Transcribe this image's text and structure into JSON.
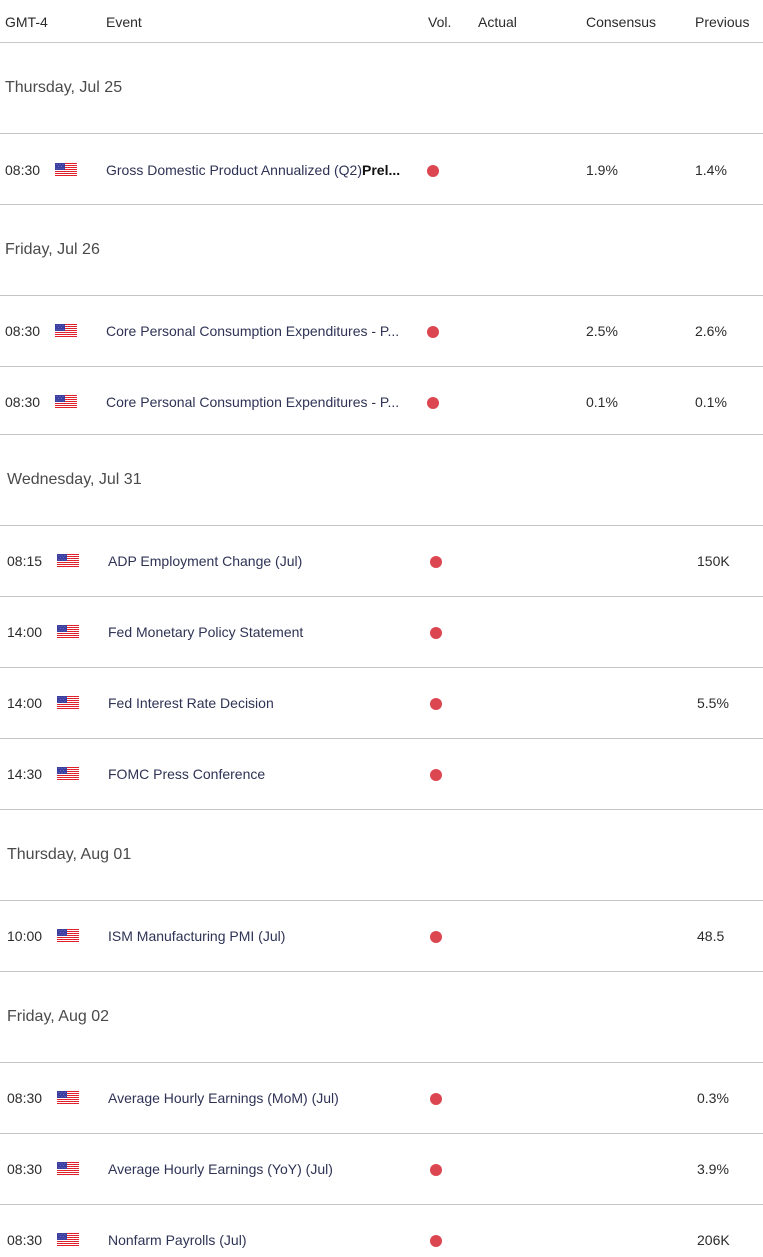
{
  "header": {
    "timezone": "GMT-4",
    "event": "Event",
    "volatility": "Vol.",
    "actual": "Actual",
    "consensus": "Consensus",
    "previous": "Previous"
  },
  "colors": {
    "volatility_high": "#dc4650",
    "divider": "#c5c5c5"
  },
  "days": [
    {
      "label": "Thursday, Jul 25",
      "events": [
        {
          "time": "08:30",
          "country_icon": "us-flag-icon",
          "event": "Gross Domestic Product Annualized (Q2)",
          "event_suffix": "Prel...",
          "volatility": "high",
          "actual": "",
          "consensus": "1.9%",
          "previous": "1.4%"
        }
      ]
    },
    {
      "label": "Friday, Jul 26",
      "events": [
        {
          "time": "08:30",
          "country_icon": "us-flag-icon",
          "event": "Core Personal Consumption Expenditures - P...",
          "event_suffix": "",
          "volatility": "high",
          "actual": "",
          "consensus": "2.5%",
          "previous": "2.6%"
        },
        {
          "time": "08:30",
          "country_icon": "us-flag-icon",
          "event": "Core Personal Consumption Expenditures - P...",
          "event_suffix": "",
          "volatility": "high",
          "actual": "",
          "consensus": "0.1%",
          "previous": "0.1%"
        }
      ]
    },
    {
      "label": "Wednesday, Jul 31",
      "events": [
        {
          "time": "08:15",
          "country_icon": "us-flag-icon",
          "event": "ADP Employment Change (Jul)",
          "event_suffix": "",
          "volatility": "high",
          "actual": "",
          "consensus": "",
          "previous": "150K"
        },
        {
          "time": "14:00",
          "country_icon": "us-flag-icon",
          "event": "Fed Monetary Policy Statement",
          "event_suffix": "",
          "volatility": "high",
          "actual": "",
          "consensus": "",
          "previous": ""
        },
        {
          "time": "14:00",
          "country_icon": "us-flag-icon",
          "event": "Fed Interest Rate Decision",
          "event_suffix": "",
          "volatility": "high",
          "actual": "",
          "consensus": "",
          "previous": "5.5%"
        },
        {
          "time": "14:30",
          "country_icon": "us-flag-icon",
          "event": "FOMC Press Conference",
          "event_suffix": "",
          "volatility": "high",
          "actual": "",
          "consensus": "",
          "previous": ""
        }
      ]
    },
    {
      "label": "Thursday, Aug 01",
      "events": [
        {
          "time": "10:00",
          "country_icon": "us-flag-icon",
          "event": "ISM Manufacturing PMI (Jul)",
          "event_suffix": "",
          "volatility": "high",
          "actual": "",
          "consensus": "",
          "previous": "48.5"
        }
      ]
    },
    {
      "label": "Friday, Aug 02",
      "events": [
        {
          "time": "08:30",
          "country_icon": "us-flag-icon",
          "event": "Average Hourly Earnings (MoM) (Jul)",
          "event_suffix": "",
          "volatility": "high",
          "actual": "",
          "consensus": "",
          "previous": "0.3%"
        },
        {
          "time": "08:30",
          "country_icon": "us-flag-icon",
          "event": "Average Hourly Earnings (YoY) (Jul)",
          "event_suffix": "",
          "volatility": "high",
          "actual": "",
          "consensus": "",
          "previous": "3.9%"
        },
        {
          "time": "08:30",
          "country_icon": "us-flag-icon",
          "event": "Nonfarm Payrolls (Jul)",
          "event_suffix": "",
          "volatility": "high",
          "actual": "",
          "consensus": "",
          "previous": "206K"
        }
      ]
    }
  ]
}
